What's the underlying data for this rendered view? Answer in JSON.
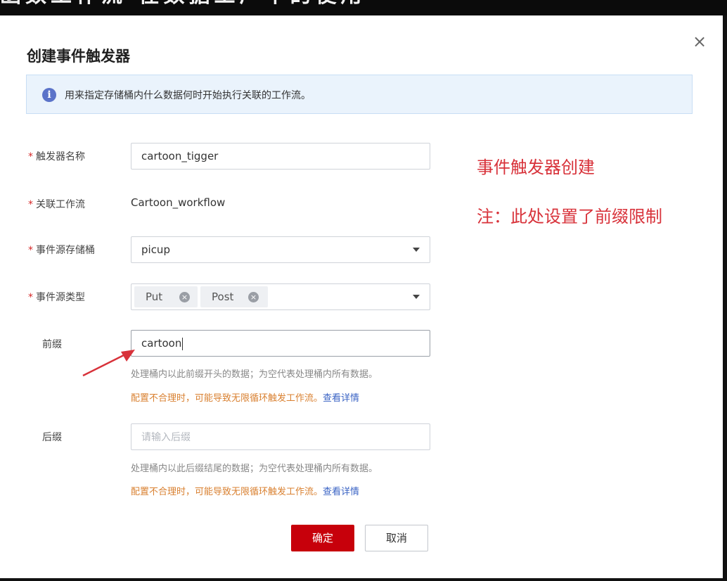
{
  "banner": {
    "text": "函数工作流 在数据工厂中的使用"
  },
  "dialog": {
    "title": "创建事件触发器",
    "info": "用来指定存储桶内什么数据何时开始执行关联的工作流。",
    "form": {
      "trigger_name": {
        "label": "触发器名称",
        "value": "cartoon_tigger"
      },
      "workflow": {
        "label": "关联工作流",
        "value": "Cartoon_workflow"
      },
      "bucket": {
        "label": "事件源存储桶",
        "value": "picup"
      },
      "event_type": {
        "label": "事件源类型",
        "tags": [
          "Put",
          "Post"
        ]
      },
      "prefix": {
        "label": "前缀",
        "value": "cartoon",
        "hint": "处理桶内以此前缀开头的数据；为空代表处理桶内所有数据。",
        "warn": "配置不合理时，可能导致无限循环触发工作流。",
        "link": "查看详情"
      },
      "suffix": {
        "label": "后缀",
        "placeholder": "请输入后缀",
        "hint": "处理桶内以此后缀结尾的数据；为空代表处理桶内所有数据。",
        "warn": "配置不合理时，可能导致无限循环触发工作流。",
        "link": "查看详情"
      }
    },
    "buttons": {
      "ok": "确定",
      "cancel": "取消"
    },
    "close": "×"
  },
  "annotation": {
    "line1": "事件触发器创建",
    "line2": "注：此处设置了前缀限制",
    "color": "#d8323a"
  },
  "colors": {
    "primary": "#c7000b",
    "info_bg": "#eaf3fc",
    "required": "#d62929"
  }
}
